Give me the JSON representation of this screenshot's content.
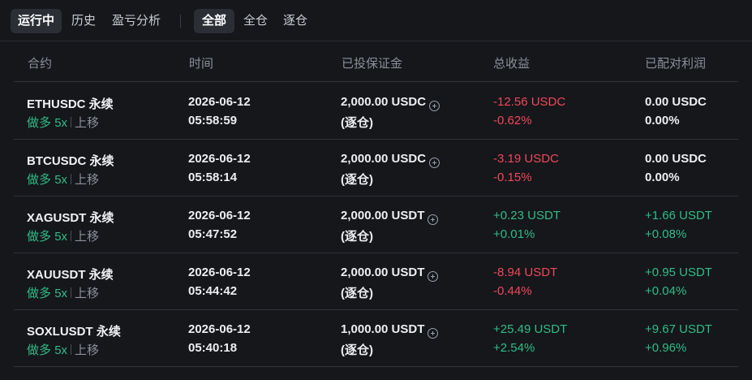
{
  "tabs": {
    "primary": [
      "运行中",
      "历史",
      "盈亏分析"
    ],
    "secondary": [
      "全部",
      "全仓",
      "逐仓"
    ]
  },
  "columns": [
    "合约",
    "时间",
    "已投保证金",
    "总收益",
    "已配对利润"
  ],
  "rows": [
    {
      "symbol": "ETHUSDC 永续",
      "side": "做多",
      "leverage": "5x",
      "trend": "上移",
      "date": "2026-06-12",
      "time": "05:58:59",
      "margin": "2,000.00 USDC",
      "margin_mode": "(逐仓)",
      "total_pnl": "-12.56 USDC",
      "total_pnl_pct": "-0.62%",
      "matched_profit": "0.00 USDC",
      "matched_profit_pct": "0.00%"
    },
    {
      "symbol": "BTCUSDC 永续",
      "side": "做多",
      "leverage": "5x",
      "trend": "上移",
      "date": "2026-06-12",
      "time": "05:58:14",
      "margin": "2,000.00 USDC",
      "margin_mode": "(逐仓)",
      "total_pnl": "-3.19 USDC",
      "total_pnl_pct": "-0.15%",
      "matched_profit": "0.00 USDC",
      "matched_profit_pct": "0.00%"
    },
    {
      "symbol": "XAGUSDT 永续",
      "side": "做多",
      "leverage": "5x",
      "trend": "上移",
      "date": "2026-06-12",
      "time": "05:47:52",
      "margin": "2,000.00 USDT",
      "margin_mode": "(逐仓)",
      "total_pnl": "+0.23 USDT",
      "total_pnl_pct": "+0.01%",
      "matched_profit": "+1.66 USDT",
      "matched_profit_pct": "+0.08%"
    },
    {
      "symbol": "XAUUSDT 永续",
      "side": "做多",
      "leverage": "5x",
      "trend": "上移",
      "date": "2026-06-12",
      "time": "05:44:42",
      "margin": "2,000.00 USDT",
      "margin_mode": "(逐仓)",
      "total_pnl": "-8.94 USDT",
      "total_pnl_pct": "-0.44%",
      "matched_profit": "+0.95 USDT",
      "matched_profit_pct": "+0.04%"
    },
    {
      "symbol": "SOXLUSDT 永续",
      "side": "做多",
      "leverage": "5x",
      "trend": "上移",
      "date": "2026-06-12",
      "time": "05:40:18",
      "margin": "1,000.00 USDT",
      "margin_mode": "(逐仓)",
      "total_pnl": "+25.49 USDT",
      "total_pnl_pct": "+2.54%",
      "matched_profit": "+9.67 USDT",
      "matched_profit_pct": "+0.96%"
    }
  ],
  "colors": {
    "background": "#15171b",
    "positive": "#2fbd85",
    "negative": "#f0475c",
    "muted": "#8c9099",
    "active_tab_bg": "#2b2e35"
  },
  "icons": {
    "add_margin": "plus-circle-icon"
  }
}
